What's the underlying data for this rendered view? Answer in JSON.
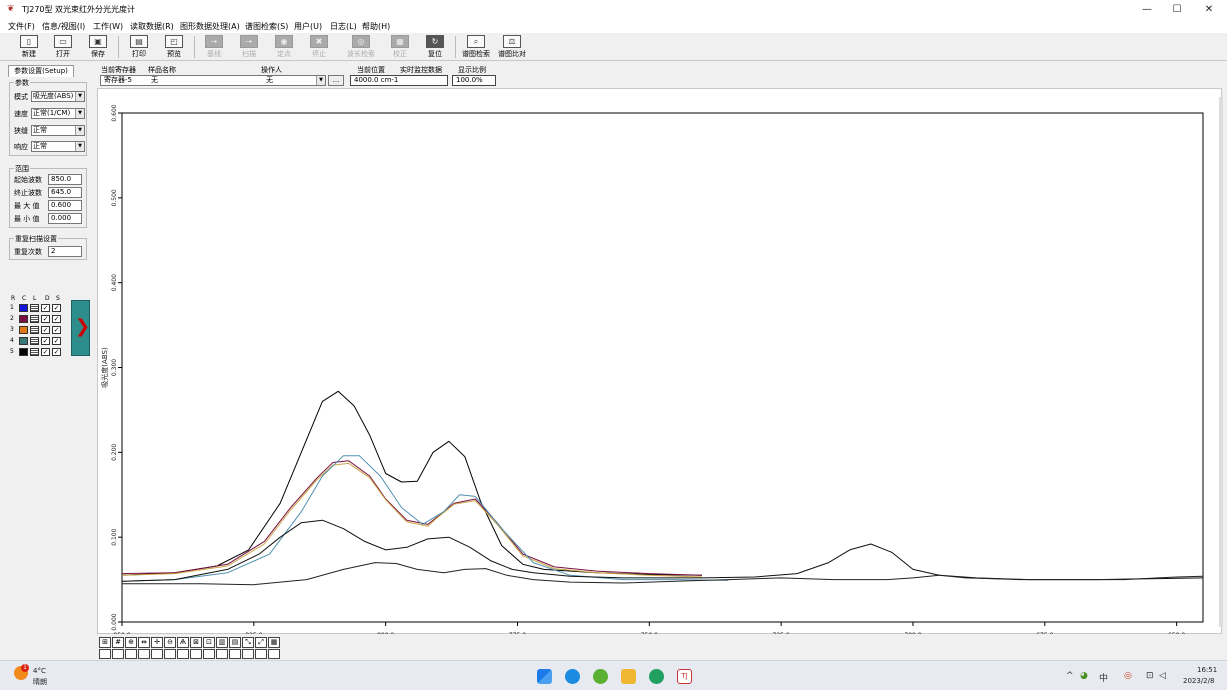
{
  "window": {
    "title": "TJ270型 双光束红外分光光度计",
    "min": "—",
    "max": "☐",
    "close": "✕"
  },
  "menu": [
    "文件(F)",
    "信息/视图(I)",
    "工作(W)",
    "读取数据(R)",
    "图形数据处理(A)",
    "谱图检索(S)",
    "用户(U)",
    "日志(L)",
    "帮助(H)"
  ],
  "toolbar": [
    {
      "label": "新建",
      "icon": "new-icon",
      "enabled": true
    },
    {
      "label": "打开",
      "icon": "open-icon",
      "enabled": true
    },
    {
      "label": "保存",
      "icon": "save-icon",
      "enabled": true
    },
    {
      "label": "打印",
      "icon": "print-icon",
      "enabled": true
    },
    {
      "label": "预览",
      "icon": "preview-icon",
      "enabled": true
    },
    {
      "label": "基线",
      "icon": "baseline-icon",
      "enabled": false
    },
    {
      "label": "扫描",
      "icon": "scan-icon",
      "enabled": false
    },
    {
      "label": "定点",
      "icon": "fixed-point-icon",
      "enabled": false
    },
    {
      "label": "停止",
      "icon": "stop-icon",
      "enabled": false
    },
    {
      "label": "波长检索",
      "icon": "wavelength-search-icon",
      "enabled": false
    },
    {
      "label": "校正",
      "icon": "calibrate-icon",
      "enabled": false
    },
    {
      "label": "复位",
      "icon": "reset-icon",
      "enabled": true
    },
    {
      "label": "谱图检索",
      "icon": "spectrum-search-icon",
      "enabled": true
    },
    {
      "label": "谱图比对",
      "icon": "spectrum-compare-icon",
      "enabled": true
    }
  ],
  "setup": {
    "tab": "参数设置(Setup)",
    "params_title": "参数",
    "mode_label": "模式",
    "mode_value": "吸光度(ABS)",
    "speed_label": "速度",
    "speed_value": "正常(1/CM)",
    "slit_label": "狭缝",
    "slit_value": "正常",
    "response_label": "响应",
    "response_value": "正常",
    "range_title": "范围",
    "start_label": "起始波数",
    "start_value": "850.0",
    "end_label": "终止波数",
    "end_value": "645.0",
    "max_label": "最 大 值",
    "max_value": "0.600",
    "min_label": "最 小 值",
    "min_value": "0.000",
    "repeat_title": "重复扫描设置",
    "repeat_label": "重复次数",
    "repeat_value": "2"
  },
  "channels": {
    "header": [
      "R",
      "C",
      "L",
      "D",
      "S"
    ],
    "rows": [
      {
        "num": "1",
        "color": "#1414d8"
      },
      {
        "num": "2",
        "color": "#7a1040"
      },
      {
        "num": "3",
        "color": "#e07818"
      },
      {
        "num": "4",
        "color": "#3a7878"
      },
      {
        "num": "5",
        "color": "#000000"
      }
    ]
  },
  "header": {
    "register_label": "当前寄存器",
    "register_value": "寄存器-5",
    "sample_label": "样品名称",
    "sample_value": "无",
    "operator_label": "操作人",
    "operator_value": "无",
    "more": "...",
    "position_label": "当前位置",
    "position_value": "4000.0 cm-1",
    "monitor_label": "实时监控数据",
    "scale_label": "显示比例",
    "scale_value": "100.0%"
  },
  "chart_data": {
    "type": "line",
    "ylabel": "吸光度(ABS)",
    "xlabel": "",
    "xlim": [
      850.0,
      645.0
    ],
    "ylim": [
      0.0,
      0.6
    ],
    "x_ticks": [
      "850.0",
      "825.0",
      "800.0",
      "775.0",
      "750.0",
      "725.0",
      "700.0",
      "675.0",
      "650.0"
    ],
    "y_ticks": [
      "0.000",
      "0.100",
      "0.200",
      "0.300",
      "0.400",
      "0.500",
      "0.600"
    ],
    "series": [
      {
        "color": "#000000",
        "x": [
          850,
          840,
          832,
          826,
          820,
          815,
          812,
          809,
          806,
          803,
          800,
          797,
          794,
          791,
          788,
          785,
          782,
          778,
          774,
          770,
          760,
          750,
          740
        ],
        "y": [
          0.055,
          0.058,
          0.066,
          0.085,
          0.14,
          0.215,
          0.26,
          0.272,
          0.255,
          0.22,
          0.175,
          0.165,
          0.166,
          0.2,
          0.213,
          0.195,
          0.142,
          0.09,
          0.068,
          0.062,
          0.058,
          0.056,
          0.055
        ]
      },
      {
        "color": "#7a1040",
        "x": [
          850,
          840,
          830,
          823,
          818,
          813,
          810,
          807,
          803,
          800,
          796,
          792,
          790,
          787,
          783,
          779,
          774,
          768,
          760,
          750,
          740
        ],
        "y": [
          0.057,
          0.058,
          0.068,
          0.095,
          0.135,
          0.17,
          0.188,
          0.19,
          0.172,
          0.145,
          0.12,
          0.115,
          0.125,
          0.14,
          0.145,
          0.118,
          0.08,
          0.065,
          0.06,
          0.057,
          0.055
        ]
      },
      {
        "color": "#c8a848",
        "x": [
          850,
          840,
          830,
          823,
          818,
          813,
          810,
          807,
          803,
          800,
          796,
          792,
          790,
          787,
          783,
          779,
          774,
          768,
          760,
          750,
          740
        ],
        "y": [
          0.055,
          0.057,
          0.066,
          0.092,
          0.132,
          0.168,
          0.185,
          0.187,
          0.17,
          0.144,
          0.118,
          0.113,
          0.124,
          0.139,
          0.143,
          0.116,
          0.078,
          0.063,
          0.058,
          0.055,
          0.053
        ]
      },
      {
        "color": "#5090b0",
        "x": [
          850,
          840,
          830,
          822,
          816,
          812,
          808,
          805,
          801,
          797,
          793,
          789,
          786,
          783,
          778,
          772,
          765,
          755,
          745,
          735
        ],
        "y": [
          0.048,
          0.05,
          0.058,
          0.08,
          0.13,
          0.172,
          0.196,
          0.196,
          0.172,
          0.135,
          0.115,
          0.13,
          0.15,
          0.148,
          0.11,
          0.07,
          0.055,
          0.05,
          0.05,
          0.049
        ]
      },
      {
        "color": "#101010",
        "x": [
          850,
          840,
          830,
          824,
          820,
          816,
          812,
          808,
          804,
          800,
          796,
          792,
          788,
          784,
          780,
          776,
          772,
          765,
          755,
          740,
          730,
          722,
          716,
          712,
          708,
          704,
          700,
          695,
          688,
          678,
          665,
          655,
          645
        ],
        "y": [
          0.048,
          0.05,
          0.062,
          0.08,
          0.1,
          0.117,
          0.12,
          0.11,
          0.095,
          0.085,
          0.088,
          0.098,
          0.1,
          0.088,
          0.072,
          0.062,
          0.058,
          0.054,
          0.052,
          0.052,
          0.053,
          0.057,
          0.07,
          0.085,
          0.092,
          0.082,
          0.062,
          0.055,
          0.052,
          0.05,
          0.05,
          0.051,
          0.052
        ]
      },
      {
        "color": "#222222",
        "x": [
          850,
          835,
          825,
          815,
          808,
          802,
          798,
          794,
          789,
          785,
          781,
          777,
          772,
          765,
          755,
          745,
          735,
          725,
          715,
          705,
          700,
          695,
          690,
          680,
          670,
          660,
          650,
          645
        ],
        "y": [
          0.045,
          0.045,
          0.044,
          0.05,
          0.062,
          0.07,
          0.069,
          0.062,
          0.058,
          0.062,
          0.063,
          0.055,
          0.05,
          0.047,
          0.046,
          0.048,
          0.05,
          0.052,
          0.05,
          0.05,
          0.052,
          0.055,
          0.052,
          0.05,
          0.05,
          0.05,
          0.053,
          0.054
        ]
      }
    ]
  },
  "bottom_tools": [
    "fit",
    "grid",
    "zoom-in",
    "pan-h",
    "pan-v",
    "zoom-out",
    "peak",
    "area",
    "derivative",
    "smooth",
    "range",
    "autoscale",
    "export",
    "ruler"
  ],
  "taskbar": {
    "temp": "4°C",
    "weather": "晴朗",
    "alert": "1",
    "tray_lang": "中",
    "time": "16:51",
    "date": "2023/2/8"
  }
}
